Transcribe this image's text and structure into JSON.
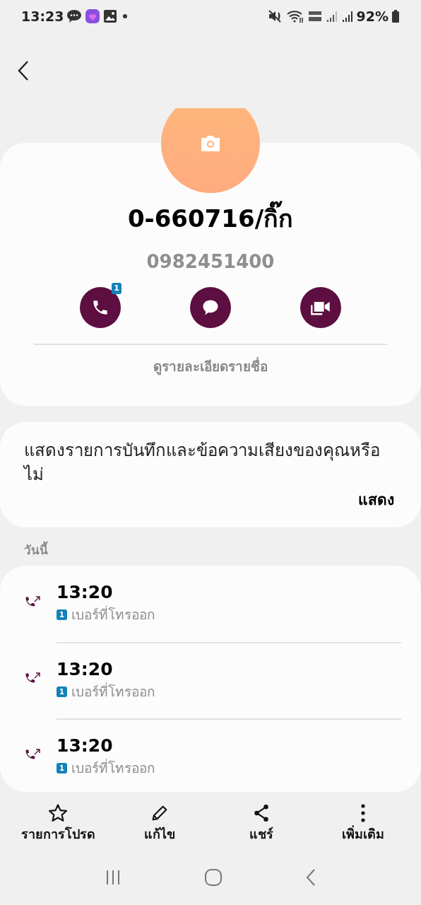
{
  "status_bar": {
    "time": "13:23",
    "battery": "92%"
  },
  "contact": {
    "name": "0-660716/กิ๊ก",
    "number": "0982451400",
    "details_link": "ดูรายละเอียดรายชื่อ"
  },
  "actions": [
    {
      "kind": "call",
      "badge": "1"
    },
    {
      "kind": "message"
    },
    {
      "kind": "video"
    }
  ],
  "prompt": {
    "text": "แสดงรายการบันทึกและข้อความเสียงของคุณหรือไม่",
    "button": "แสดง"
  },
  "section_label": "วันนี้",
  "call_log": [
    {
      "time": "13:20",
      "sim": "1",
      "label": "เบอร์ที่โทรออก"
    },
    {
      "time": "13:20",
      "sim": "1",
      "label": "เบอร์ที่โทรออก"
    },
    {
      "time": "13:20",
      "sim": "1",
      "label": "เบอร์ที่โทรออก"
    }
  ],
  "bottom_bar": [
    {
      "kind": "star",
      "label": "รายการโปรด"
    },
    {
      "kind": "edit",
      "label": "แก้ไข"
    },
    {
      "kind": "share",
      "label": "แชร์"
    },
    {
      "kind": "more",
      "label": "เพิ่มเติม"
    }
  ]
}
